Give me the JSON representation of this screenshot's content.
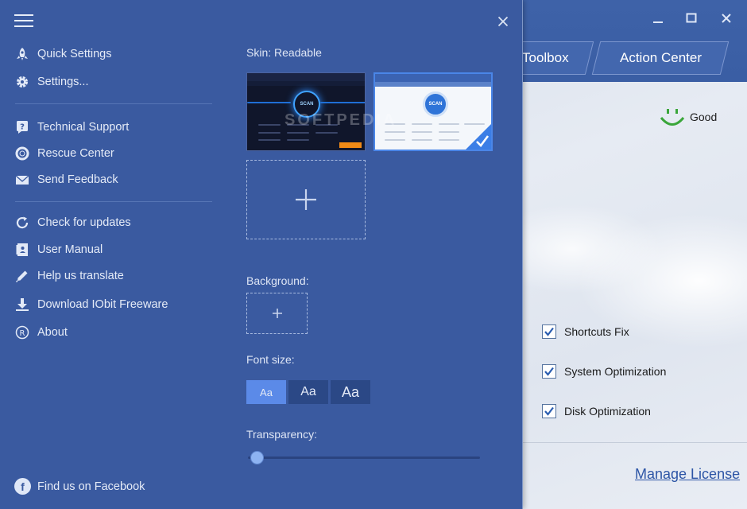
{
  "app": {
    "tabs": [
      "Toolbox",
      "Action Center"
    ],
    "status": "Good",
    "checks": [
      {
        "label": "Shortcuts Fix",
        "checked": true
      },
      {
        "label": "System Optimization",
        "checked": true
      },
      {
        "label": "Disk Optimization",
        "checked": true
      }
    ],
    "manage_license": "Manage License"
  },
  "panel": {
    "menu_group1": [
      "Quick Settings",
      "Settings..."
    ],
    "menu_group2": [
      "Technical Support",
      "Rescue Center",
      "Send Feedback"
    ],
    "menu_group3": [
      "Check for updates",
      "User Manual",
      "Help us translate",
      "Download IObit Freeware",
      "About"
    ],
    "skin_label": "Skin: Readable",
    "background_label": "Background:",
    "font_size_label": "Font size:",
    "font_size_options": [
      "Aa",
      "Aa",
      "Aa"
    ],
    "font_size_selected_index": 0,
    "transparency_label": "Transparency:",
    "transparency_value": 0.04,
    "facebook": "Find us on Facebook",
    "watermark": "SOFTPEDIA",
    "thumb_scan": "SCAN"
  },
  "colors": {
    "panel": "#3a5aa0",
    "accent": "#4a86e8",
    "good": "#3aa63a"
  }
}
